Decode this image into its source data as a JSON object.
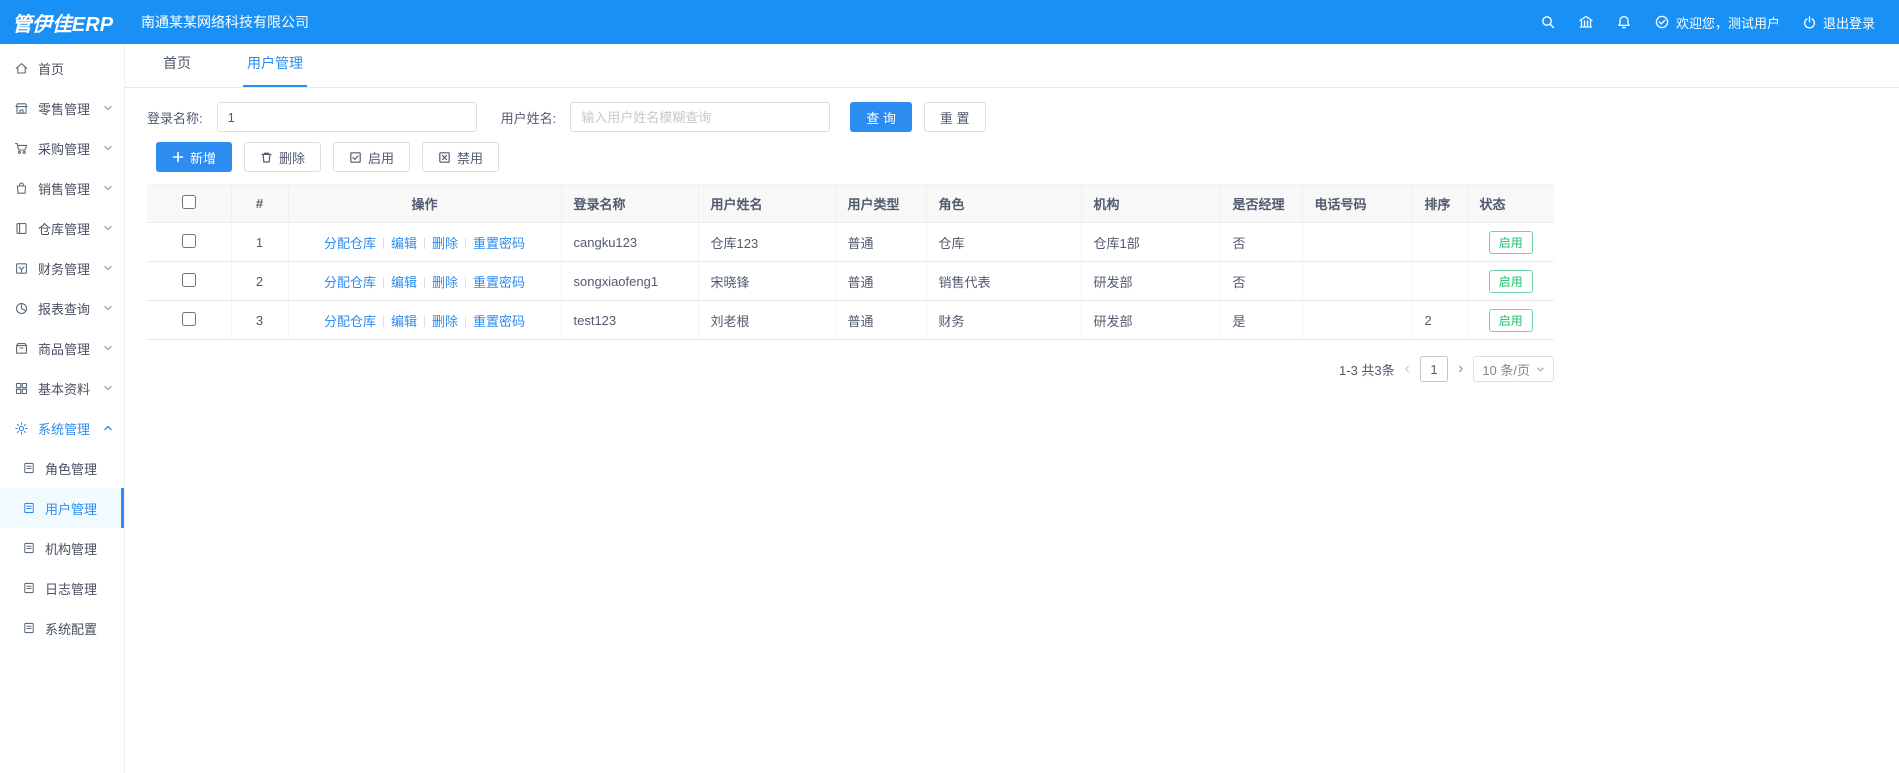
{
  "colors": {
    "topbar": "#1890f5",
    "accent": "#2d8cf0",
    "success": "#19be6b"
  },
  "topbar": {
    "logo": "管伊佳ERP",
    "company": "南通某某网络科技有限公司",
    "welcome": "欢迎您，测试用户",
    "logout": "退出登录"
  },
  "sidebar": {
    "items": [
      {
        "label": "首页"
      },
      {
        "label": "零售管理"
      },
      {
        "label": "采购管理"
      },
      {
        "label": "销售管理"
      },
      {
        "label": "仓库管理"
      },
      {
        "label": "财务管理"
      },
      {
        "label": "报表查询"
      },
      {
        "label": "商品管理"
      },
      {
        "label": "基本资料"
      },
      {
        "label": "系统管理"
      }
    ],
    "submenu": [
      "角色管理",
      "用户管理",
      "机构管理",
      "日志管理",
      "系统配置"
    ]
  },
  "tabs": [
    "首页",
    "用户管理"
  ],
  "filter": {
    "login_label": "登录名称:",
    "login_value": "1",
    "name_label": "用户姓名:",
    "name_placeholder": "输入用户姓名模糊查询",
    "search_label": "查 询",
    "reset_label": "重 置"
  },
  "toolbar": {
    "add_label": "新增",
    "delete_label": "删除",
    "enable_label": "启用",
    "disable_label": "禁用"
  },
  "table": {
    "headers": [
      "#",
      "操作",
      "登录名称",
      "用户姓名",
      "用户类型",
      "角色",
      "机构",
      "是否经理",
      "电话号码",
      "排序",
      "状态"
    ],
    "op_links": [
      "分配仓库",
      "编辑",
      "删除",
      "重置密码"
    ],
    "rows": [
      {
        "index": "1",
        "login": "cangku123",
        "name": "仓库123",
        "type": "普通",
        "role": "仓库",
        "org": "仓库1部",
        "manager": "否",
        "phone": "",
        "sort": "",
        "status": "启用"
      },
      {
        "index": "2",
        "login": "songxiaofeng1",
        "name": "宋晓锋",
        "type": "普通",
        "role": "销售代表",
        "org": "研发部",
        "manager": "否",
        "phone": "",
        "sort": "",
        "status": "启用"
      },
      {
        "index": "3",
        "login": "test123",
        "name": "刘老根",
        "type": "普通",
        "role": "财务",
        "org": "研发部",
        "manager": "是",
        "phone": "",
        "sort": "2",
        "status": "启用"
      }
    ]
  },
  "pagination": {
    "range": "1-3 共3条",
    "page": "1",
    "size": "10 条/页"
  }
}
